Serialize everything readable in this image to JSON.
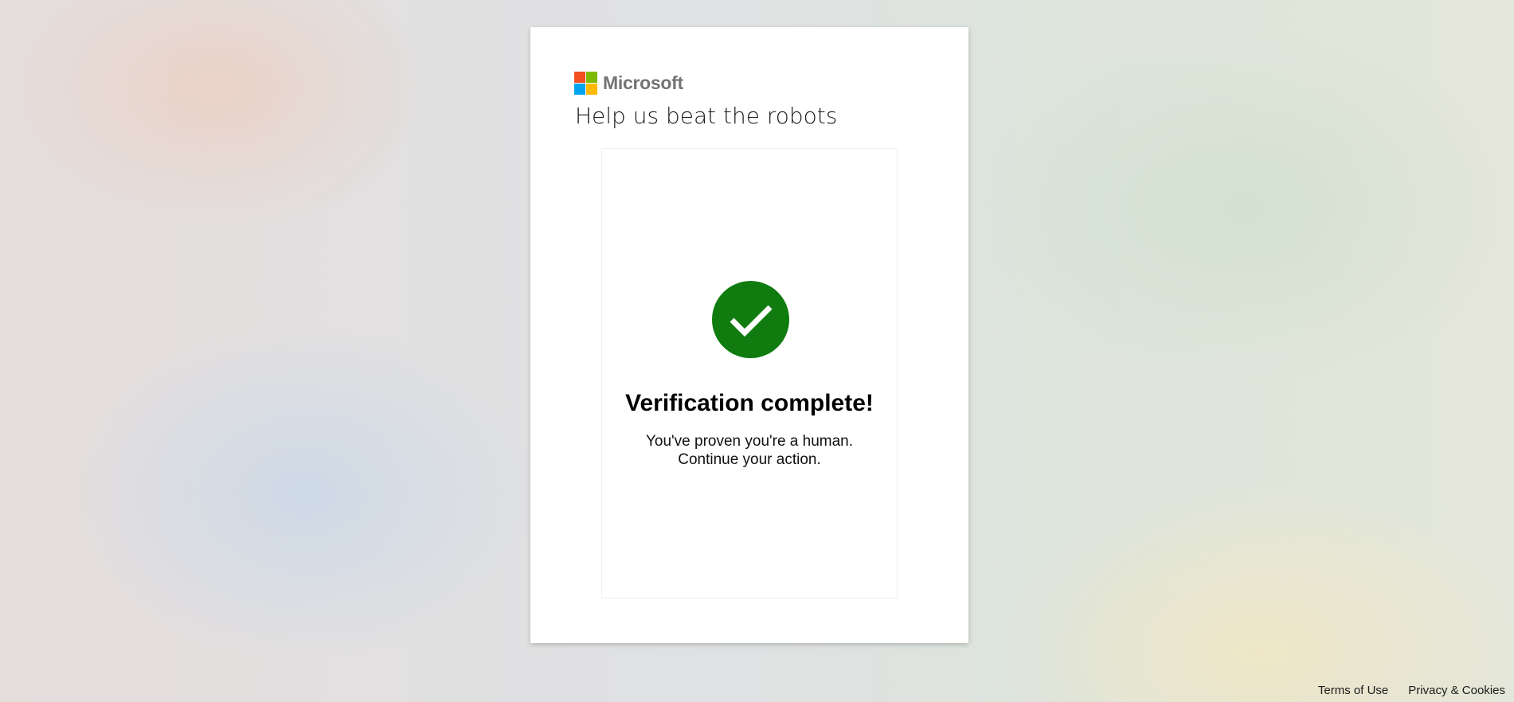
{
  "brand": {
    "name": "Microsoft",
    "logo_icon": "microsoft-logo-icon",
    "logo_colors": [
      "#f25022",
      "#7fba00",
      "#00a4ef",
      "#ffb900"
    ]
  },
  "page": {
    "title": "Help us beat the robots"
  },
  "verification": {
    "icon": "checkmark-circle-icon",
    "success_color": "#107c10",
    "heading": "Verification complete!",
    "message_line1": "You've proven you're a human.",
    "message_line2": "Continue your action."
  },
  "footer": {
    "terms_label": "Terms of Use",
    "privacy_label": "Privacy & Cookies"
  }
}
